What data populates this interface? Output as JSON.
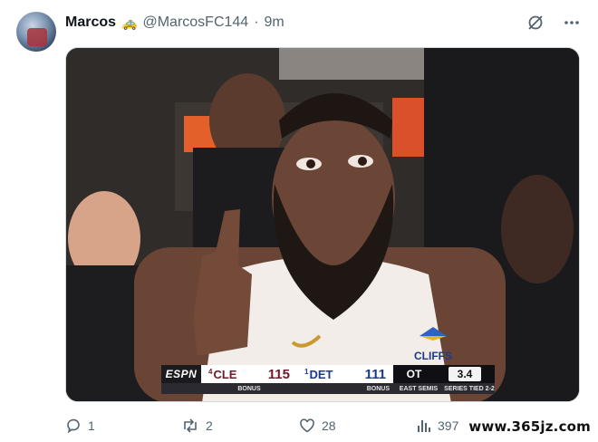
{
  "post": {
    "display_name": "Marcos",
    "badge_emoji": "🚕",
    "handle": "@MarcosFC144",
    "separator": "·",
    "time": "9m"
  },
  "top_icons": [
    "grok-icon",
    "more-icon"
  ],
  "media": {
    "scorebug": {
      "network": "ESPN",
      "team_a": {
        "seed": "4",
        "abbr": "CLE",
        "score": "115",
        "color": "#6d1a2b"
      },
      "team_b": {
        "seed": "1",
        "abbr": "DET",
        "score": "111",
        "color": "#1d3a8a"
      },
      "period": "OT",
      "clock": "3.4",
      "bonus_a": "BONUS",
      "bonus_b": "BONUS",
      "series_name": "EAST SEMIS",
      "series_status": "SERIES TIED 2-2"
    },
    "jersey_text": "CLIFFS"
  },
  "actions": {
    "reply_count": "1",
    "repost_count": "2",
    "like_count": "28",
    "views_count": "397"
  },
  "watermark": "www.365jz.com"
}
